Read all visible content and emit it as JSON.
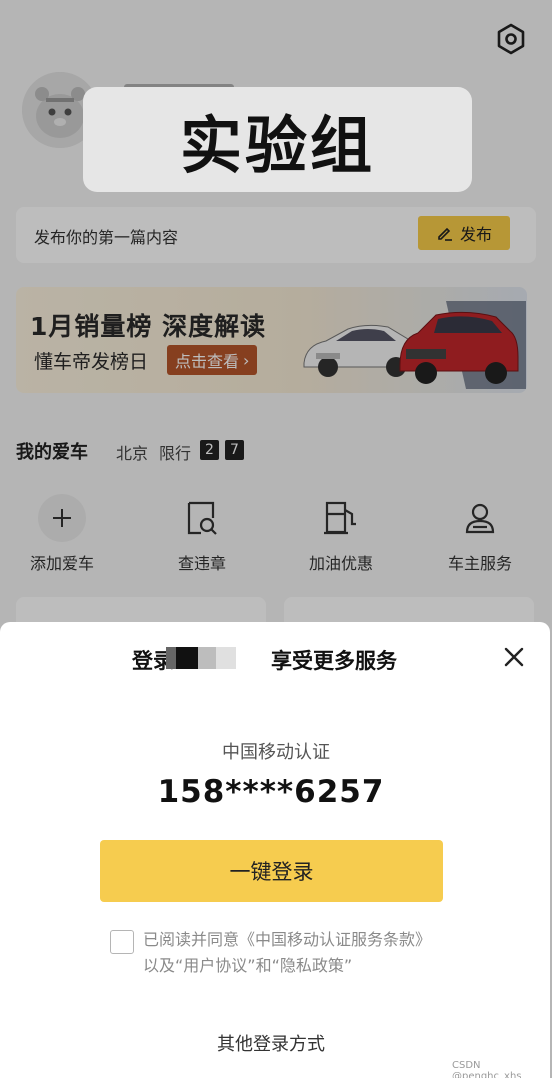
{
  "experiment_label": "实验组",
  "publish": {
    "prompt": "发布你的第一篇内容",
    "button_label": "发布"
  },
  "banner": {
    "title": "1月销量榜  深度解读",
    "subtitle": "懂车帝发榜日",
    "cta": "点击查看"
  },
  "my_car": {
    "title": "我的爱车",
    "city": "北京",
    "limit_label": "限行",
    "limit_numbers": [
      "2",
      "7"
    ]
  },
  "quick_actions": [
    {
      "label": "添加爱车",
      "icon": "plus-icon"
    },
    {
      "label": "查违章",
      "icon": "violation-search-icon"
    },
    {
      "label": "加油优惠",
      "icon": "fuel-pump-icon"
    },
    {
      "label": "车主服务",
      "icon": "owner-service-icon"
    }
  ],
  "login_sheet": {
    "title_prefix": "登录",
    "title_suffix": "享受更多服务",
    "auth_provider": "中国移动认证",
    "phone": "158****6257",
    "one_click_label": "一键登录",
    "agreement": "已阅读并同意《中国移动认证服务条款》以及“用户协议”和“隐私政策”",
    "other_login": "其他登录方式"
  },
  "watermark": "CSDN @penghc_xhs",
  "colors": {
    "accent": "#f6cc4f",
    "banner_cta": "#b5552b"
  }
}
